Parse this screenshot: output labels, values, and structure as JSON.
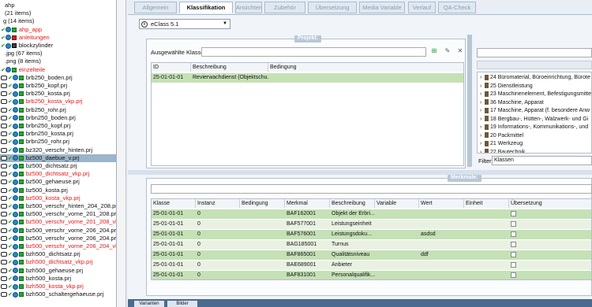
{
  "tree": [
    {
      "prefix": "",
      "icons": [],
      "text": "ahp",
      "color": "#111"
    },
    {
      "prefix": "",
      "icons": [],
      "text": "(21 items)",
      "color": "#111"
    },
    {
      "prefix": "g",
      "icons": [],
      "text": "(14 items)",
      "color": "#111"
    },
    {
      "prefix": "",
      "icons": [
        "ck",
        "gl",
        "g"
      ],
      "text": "ahp_app",
      "color": "#e01818"
    },
    {
      "prefix": "",
      "icons": [
        "ck",
        "gl",
        "r"
      ],
      "text": "anleitungen",
      "color": "#e01818"
    },
    {
      "prefix": "",
      "icons": [
        "ck",
        "gl",
        "k"
      ],
      "text": "blockzylinder",
      "color": "#111"
    },
    {
      "prefix": "",
      "icons": [],
      "text": ".jpg (67 items)",
      "color": "#111"
    },
    {
      "prefix": "",
      "icons": [],
      "text": ".png (8 items)",
      "color": "#111"
    },
    {
      "prefix": "",
      "icons": [
        "ck",
        "gl",
        "g"
      ],
      "text": "einzelteile",
      "color": "#e01818"
    },
    {
      "prefix": "",
      "icons": [
        "pr",
        "ck",
        "gl",
        "g"
      ],
      "text": "brb250_boden.prj",
      "color": "#111"
    },
    {
      "prefix": "",
      "icons": [
        "pr",
        "ck",
        "gl",
        "g"
      ],
      "text": "brb250_kopf.prj",
      "color": "#111"
    },
    {
      "prefix": "",
      "icons": [
        "pr",
        "ck",
        "gl",
        "g"
      ],
      "text": "brb250_kosta.prj",
      "color": "#111"
    },
    {
      "prefix": "",
      "icons": [
        "pr",
        "ck",
        "gl",
        "g"
      ],
      "text": "brb250_kosta_vkp.prj",
      "color": "#e01818"
    },
    {
      "prefix": "",
      "icons": [
        "pr",
        "ck",
        "gl",
        "g"
      ],
      "text": "brb250_rohr.prj",
      "color": "#111"
    },
    {
      "prefix": "",
      "icons": [
        "pr",
        "ck",
        "gl",
        "g"
      ],
      "text": "brbn250_boden.prj",
      "color": "#111"
    },
    {
      "prefix": "",
      "icons": [
        "pr",
        "ck",
        "gl",
        "g"
      ],
      "text": "brbn250_kopf.prj",
      "color": "#111"
    },
    {
      "prefix": "",
      "icons": [
        "pr",
        "ck",
        "gl",
        "g"
      ],
      "text": "brbn250_kosta.prj",
      "color": "#111"
    },
    {
      "prefix": "",
      "icons": [
        "pr",
        "ck",
        "gl",
        "g"
      ],
      "text": "brbn250_rohr.prj",
      "color": "#111"
    },
    {
      "prefix": "",
      "icons": [
        "pr",
        "ck",
        "gl",
        "g"
      ],
      "text": "bz320_verschr_hinten.prj",
      "color": "#111"
    },
    {
      "prefix": "",
      "icons": [
        "pr",
        "ck",
        "gl",
        "g"
      ],
      "text": "bz500_daebue_v.prj",
      "color": "#111",
      "selected": true
    },
    {
      "prefix": "",
      "icons": [
        "pr",
        "ck",
        "gl",
        "g"
      ],
      "text": "bz500_dichtsatz.prj",
      "color": "#111"
    },
    {
      "prefix": "",
      "icons": [
        "pr",
        "ck",
        "gl",
        "g"
      ],
      "text": "bz500_dichtsatz_vkp.prj",
      "color": "#e01818"
    },
    {
      "prefix": "",
      "icons": [
        "pr",
        "ck",
        "gl",
        "g"
      ],
      "text": "bz500_gehaeuse.prj",
      "color": "#111"
    },
    {
      "prefix": "",
      "icons": [
        "pr",
        "ck",
        "gl",
        "g"
      ],
      "text": "bz500_kosta.prj",
      "color": "#111"
    },
    {
      "prefix": "",
      "icons": [
        "pr",
        "ck",
        "gl",
        "g"
      ],
      "text": "bz500_kosta_vkp.prj",
      "color": "#e01818"
    },
    {
      "prefix": "",
      "icons": [
        "pr",
        "ck",
        "gl",
        "g"
      ],
      "text": "bz500_verschr_hinten_204_208.prj",
      "color": "#111"
    },
    {
      "prefix": "",
      "icons": [
        "pr",
        "ck",
        "gl",
        "g"
      ],
      "text": "bz500_verschr_vorne_201_208.prj",
      "color": "#111"
    },
    {
      "prefix": "",
      "icons": [
        "pr",
        "ck",
        "gl",
        "g"
      ],
      "text": "bz500_verschr_vorne_201_208_vk...",
      "color": "#e01818"
    },
    {
      "prefix": "",
      "icons": [
        "pr",
        "ck",
        "gl",
        "g"
      ],
      "text": "bz500_verschr_vorne_206_204.prj",
      "color": "#111"
    },
    {
      "prefix": "",
      "icons": [
        "pr",
        "ck",
        "gl",
        "g"
      ],
      "text": "bz500_verschr_vorne_206_204.prj",
      "color": "#111"
    },
    {
      "prefix": "",
      "icons": [
        "pr",
        "ck",
        "gl",
        "g"
      ],
      "text": "bz500_verschr_vorne_206_204_vk...",
      "color": "#e01818"
    },
    {
      "prefix": "",
      "icons": [
        "pr",
        "ck",
        "gl",
        "g"
      ],
      "text": "bzh500_dichtsatz.prj",
      "color": "#111"
    },
    {
      "prefix": "",
      "icons": [
        "pr",
        "ck",
        "gl",
        "g"
      ],
      "text": "bzh500_dichtsatz_vkp.prj",
      "color": "#e01818"
    },
    {
      "prefix": "",
      "icons": [
        "pr",
        "ck",
        "gl",
        "g"
      ],
      "text": "bzh500_gehaeuse.prj",
      "color": "#111"
    },
    {
      "prefix": "",
      "icons": [
        "pr",
        "ck",
        "gl",
        "g"
      ],
      "text": "bzh500_kosta.prj",
      "color": "#111"
    },
    {
      "prefix": "",
      "icons": [
        "pr",
        "ck",
        "gl",
        "g"
      ],
      "text": "bzh500_kosta_vkp.prj",
      "color": "#e01818"
    },
    {
      "prefix": "",
      "icons": [
        "pr",
        "ck",
        "gl",
        "g"
      ],
      "text": "bzh500_schaltergehaeuse.prj",
      "color": "#111"
    }
  ],
  "tabs": [
    {
      "label": "Allgemein",
      "active": false
    },
    {
      "label": "Klassifikation",
      "active": true
    },
    {
      "label": "Ansichten",
      "active": false
    },
    {
      "label": "Zubehör",
      "active": false
    },
    {
      "label": "Übersetzung",
      "active": false
    },
    {
      "label": "Media Variable",
      "active": false
    },
    {
      "label": "Verlauf",
      "active": false
    },
    {
      "label": "QA-Check",
      "active": false
    }
  ],
  "classification_system": "eClass 5.1",
  "project": {
    "title": "Projekt:",
    "selected_label": "Ausgewählte Klassen",
    "columns": [
      "ID",
      "Beschreibung",
      "Bedingung"
    ],
    "rows": [
      [
        "25-01-01-01",
        "Revierwachdienst (Objektschu...",
        ""
      ]
    ]
  },
  "catalog": [
    {
      "label": "24 Büromaterial, Büroeinrichtung, Bürote"
    },
    {
      "label": "25 Dienstleistung"
    },
    {
      "label": "23 Maschinenelement, Befestigungsmittel"
    },
    {
      "label": "36 Maschine, Apparat"
    },
    {
      "label": "17 Maschine, Apparat (f. besondere Anw"
    },
    {
      "label": "18 Bergbau-, Hütten-, Walzwerk- und Gi"
    },
    {
      "label": "19 Informations-, Kommunikations-, und"
    },
    {
      "label": "20 Packmittel"
    },
    {
      "label": "21 Werkzeug"
    },
    {
      "label": "22 Bautechnik"
    }
  ],
  "filter": {
    "label": "Filter:",
    "value": "Klassen"
  },
  "features": {
    "title": "Merkmale:",
    "columns": [
      "Klasse",
      "Instanz",
      "Bedingung",
      "Merkmal",
      "Beschreibung",
      "Variable",
      "Wert",
      "Einheit",
      "Übersetzung"
    ],
    "rows": [
      [
        "25-01-01-01",
        "0",
        "",
        "BAF162001",
        "Objekt der Erbri...",
        "",
        "",
        "",
        ""
      ],
      [
        "25-01-01-01",
        "0",
        "",
        "BAF577001",
        "Leistungseinheit",
        "",
        "",
        "",
        ""
      ],
      [
        "25-01-01-01",
        "0",
        "",
        "BAF576001",
        "Leistungsdoku...",
        "",
        "asdsd",
        "",
        ""
      ],
      [
        "25-01-01-01",
        "0",
        "",
        "BAG185001",
        "Turnus",
        "",
        "",
        "",
        ""
      ],
      [
        "25-01-01-01",
        "0",
        "",
        "BAF865001",
        "Qualitätsniveau",
        "",
        "ddf",
        "",
        ""
      ],
      [
        "25-01-01-01",
        "0",
        "",
        "BAE689001",
        "Anbieter",
        "",
        "",
        "",
        ""
      ],
      [
        "25-01-01-01",
        "0",
        "",
        "BAF831001",
        "Personalqualifik...",
        "",
        "",
        "",
        ""
      ]
    ]
  },
  "bottom_tabs": [
    "Varianten",
    "Bilder"
  ]
}
